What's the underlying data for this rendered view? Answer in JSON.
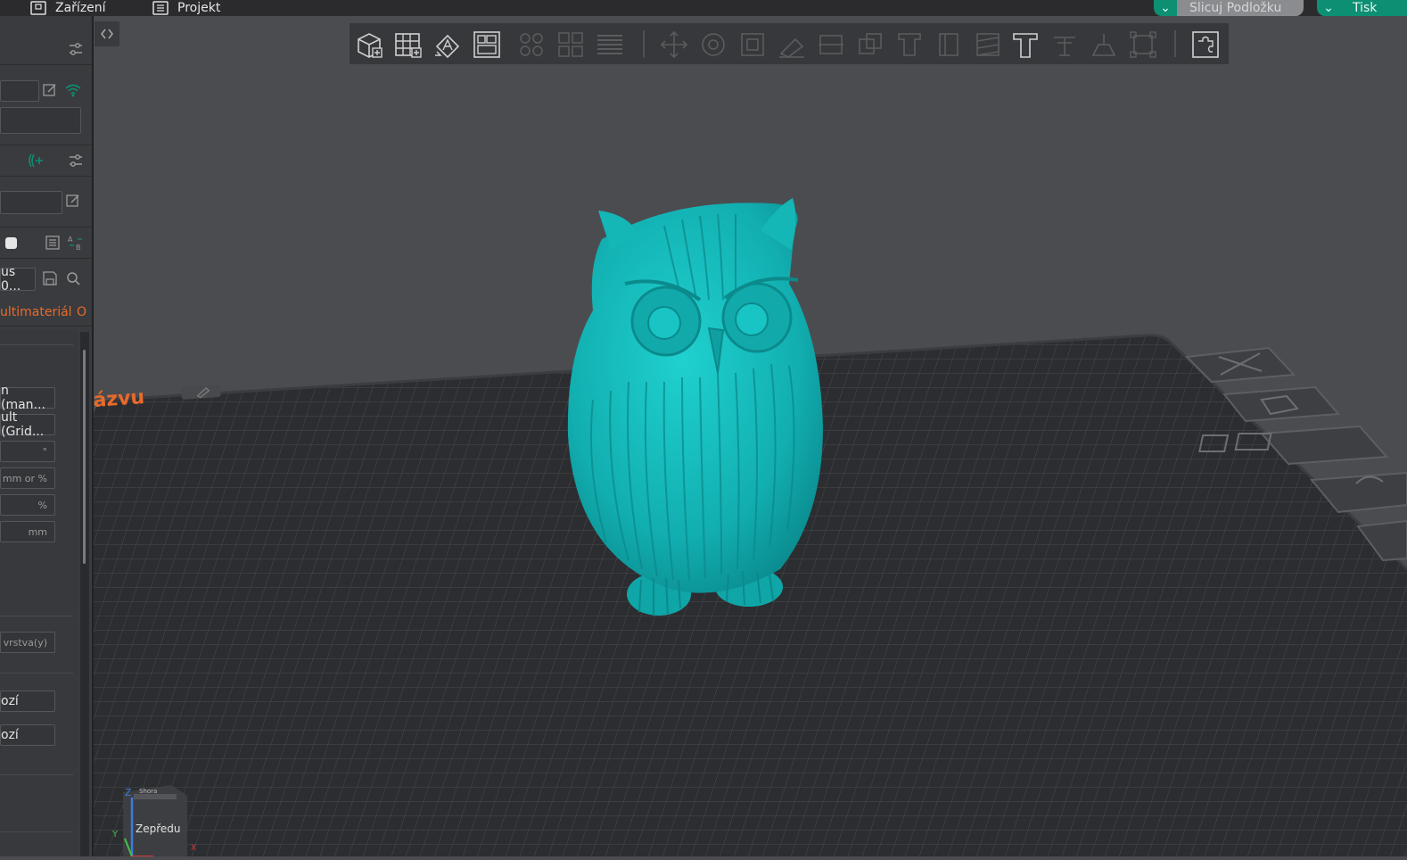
{
  "topbar": {
    "device_tab": "Zařízení",
    "project_tab": "Projekt",
    "slice_button": "Slicuj Podložku",
    "print_button": "Tisk"
  },
  "left_panel": {
    "filament_preset": "us 0...",
    "multimaterial_label": "ultimateriál",
    "multimaterial_suffix": "O",
    "fields": {
      "pattern_1": "n (man...",
      "pattern_2": "ult (Grid...",
      "angle_unit": "°",
      "mm_or_percent": "mm or %",
      "percent": "%",
      "mm": "mm",
      "layers": "vrstva(y)",
      "value_1": "ozí",
      "value_2": "ozí"
    }
  },
  "viewport": {
    "plate_name": "ázvu",
    "orientation_front": "Zepředu",
    "axis_z": "Z",
    "axis_y": "Y",
    "axis_x": "X",
    "cube_top": "Shora"
  },
  "colors": {
    "accent_green": "#0d8f73",
    "model_teal": "#15b8b8",
    "plate_dark": "#2e2f32",
    "plate_name_orange": "#e86a2b"
  }
}
